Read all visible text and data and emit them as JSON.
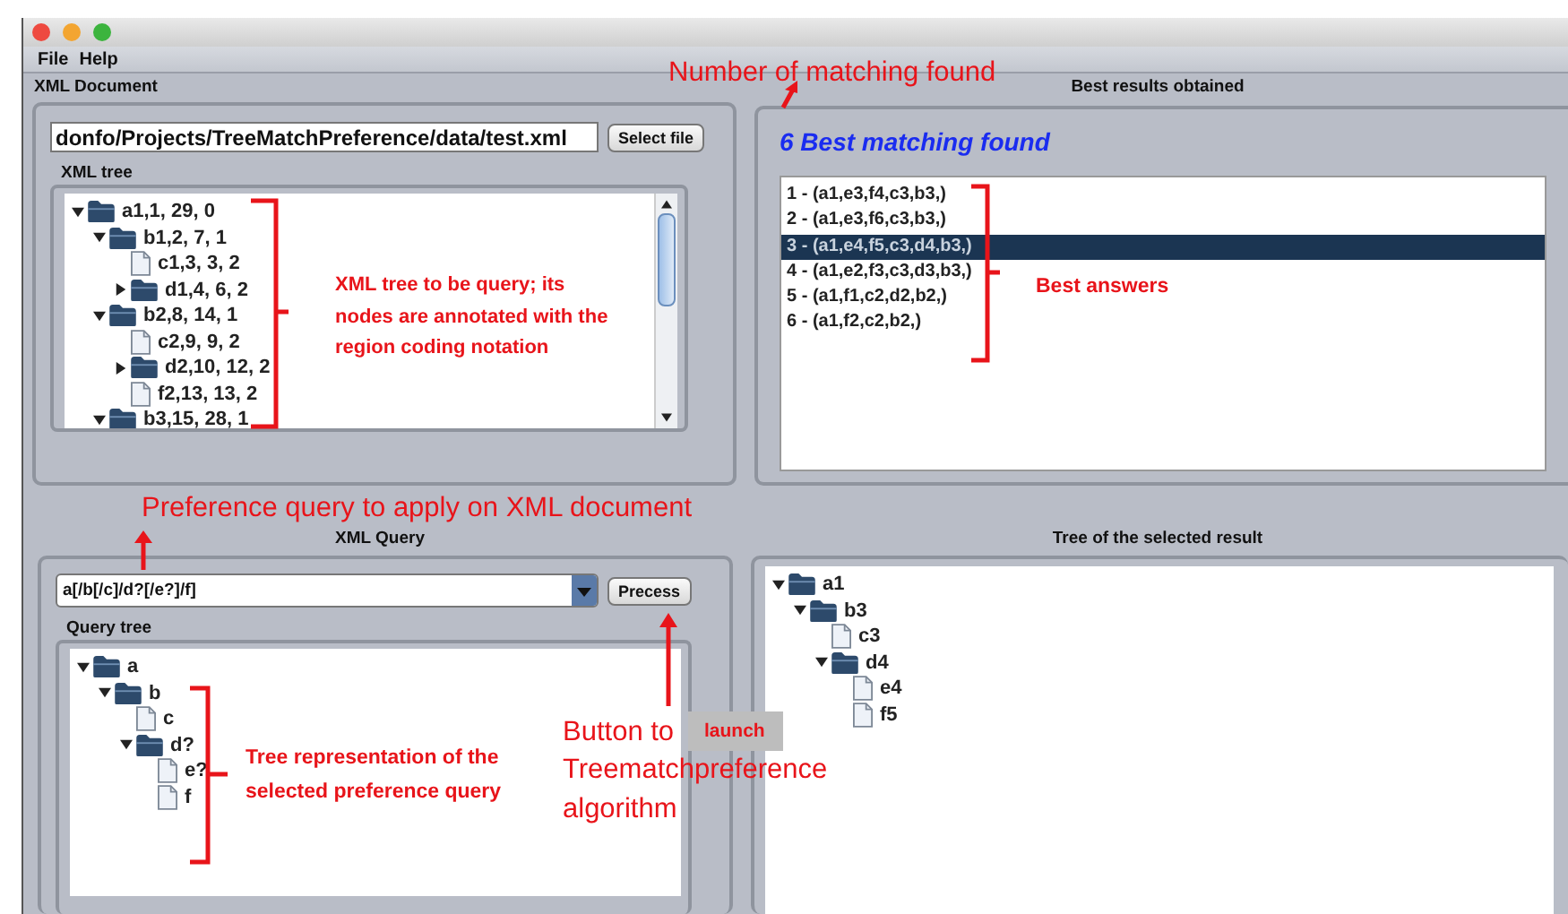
{
  "window": {
    "menu": [
      "File",
      "Help"
    ]
  },
  "xml_document": {
    "title": "XML Document",
    "path": "donfo/Projects/TreeMatchPreference/data/test.xml",
    "select_button": "Select file",
    "tree_title": "XML tree",
    "tree": [
      {
        "kind": "folder",
        "label": "a1,1, 29, 0",
        "expanded": true,
        "children": [
          {
            "kind": "folder",
            "label": "b1,2, 7, 1",
            "expanded": true,
            "children": [
              {
                "kind": "file",
                "label": "c1,3, 3, 2"
              },
              {
                "kind": "folder",
                "label": "d1,4, 6, 2",
                "expanded": false
              }
            ]
          },
          {
            "kind": "folder",
            "label": "b2,8, 14, 1",
            "expanded": true,
            "children": [
              {
                "kind": "file",
                "label": "c2,9, 9, 2"
              },
              {
                "kind": "folder",
                "label": "d2,10, 12, 2",
                "expanded": false
              },
              {
                "kind": "file",
                "label": "f2,13, 13, 2"
              }
            ]
          },
          {
            "kind": "folder",
            "label": "b3,15, 28, 1",
            "expanded": true
          }
        ]
      }
    ]
  },
  "best_results": {
    "title": "Best results obtained",
    "count_label": "6 Best matching found",
    "results": [
      {
        "label": "1 - (a1,e3,f4,c3,b3,)",
        "selected": false
      },
      {
        "label": "2 - (a1,e3,f6,c3,b3,)",
        "selected": false
      },
      {
        "label": "3 - (a1,e4,f5,c3,d4,b3,)",
        "selected": true
      },
      {
        "label": "4 - (a1,e2,f3,c3,d3,b3,)",
        "selected": false
      },
      {
        "label": "5 - (a1,f1,c2,d2,b2,)",
        "selected": false
      },
      {
        "label": "6 - (a1,f2,c2,b2,)",
        "selected": false
      }
    ]
  },
  "xml_query": {
    "title": "XML Query",
    "query": "a[/b[/c]/d?[/e?]/f]",
    "process_button": "Precess",
    "tree_title": "Query tree",
    "tree": [
      {
        "kind": "folder",
        "label": "a",
        "expanded": true,
        "children": [
          {
            "kind": "folder",
            "label": "b",
            "expanded": true,
            "children": [
              {
                "kind": "file",
                "label": "c"
              },
              {
                "kind": "folder",
                "label": "d?",
                "expanded": true,
                "children": [
                  {
                    "kind": "file",
                    "label": "e?"
                  },
                  {
                    "kind": "file",
                    "label": "f"
                  }
                ]
              }
            ]
          }
        ]
      }
    ]
  },
  "result_tree": {
    "title": "Tree of the selected result",
    "tree": [
      {
        "kind": "folder",
        "label": "a1",
        "expanded": true,
        "children": [
          {
            "kind": "folder",
            "label": "b3",
            "expanded": true,
            "children": [
              {
                "kind": "file",
                "label": "c3"
              },
              {
                "kind": "folder",
                "label": "d4",
                "expanded": true,
                "children": [
                  {
                    "kind": "file",
                    "label": "e4"
                  },
                  {
                    "kind": "file",
                    "label": "f5"
                  }
                ]
              }
            ]
          }
        ]
      }
    ]
  },
  "annotations": {
    "matching_count": "Number of matching found",
    "query_note": "Preference query to apply on XML document",
    "tree_note": "XML tree to be query; its nodes are annotated with the region coding notation",
    "answers_note": "Best answers",
    "query_tree_note": "Tree representation of the selected preference query",
    "button_note": {
      "prefix": "Button to",
      "highlight": "launch",
      "rest": "Treematchpreference",
      "last": "algorithm"
    }
  }
}
